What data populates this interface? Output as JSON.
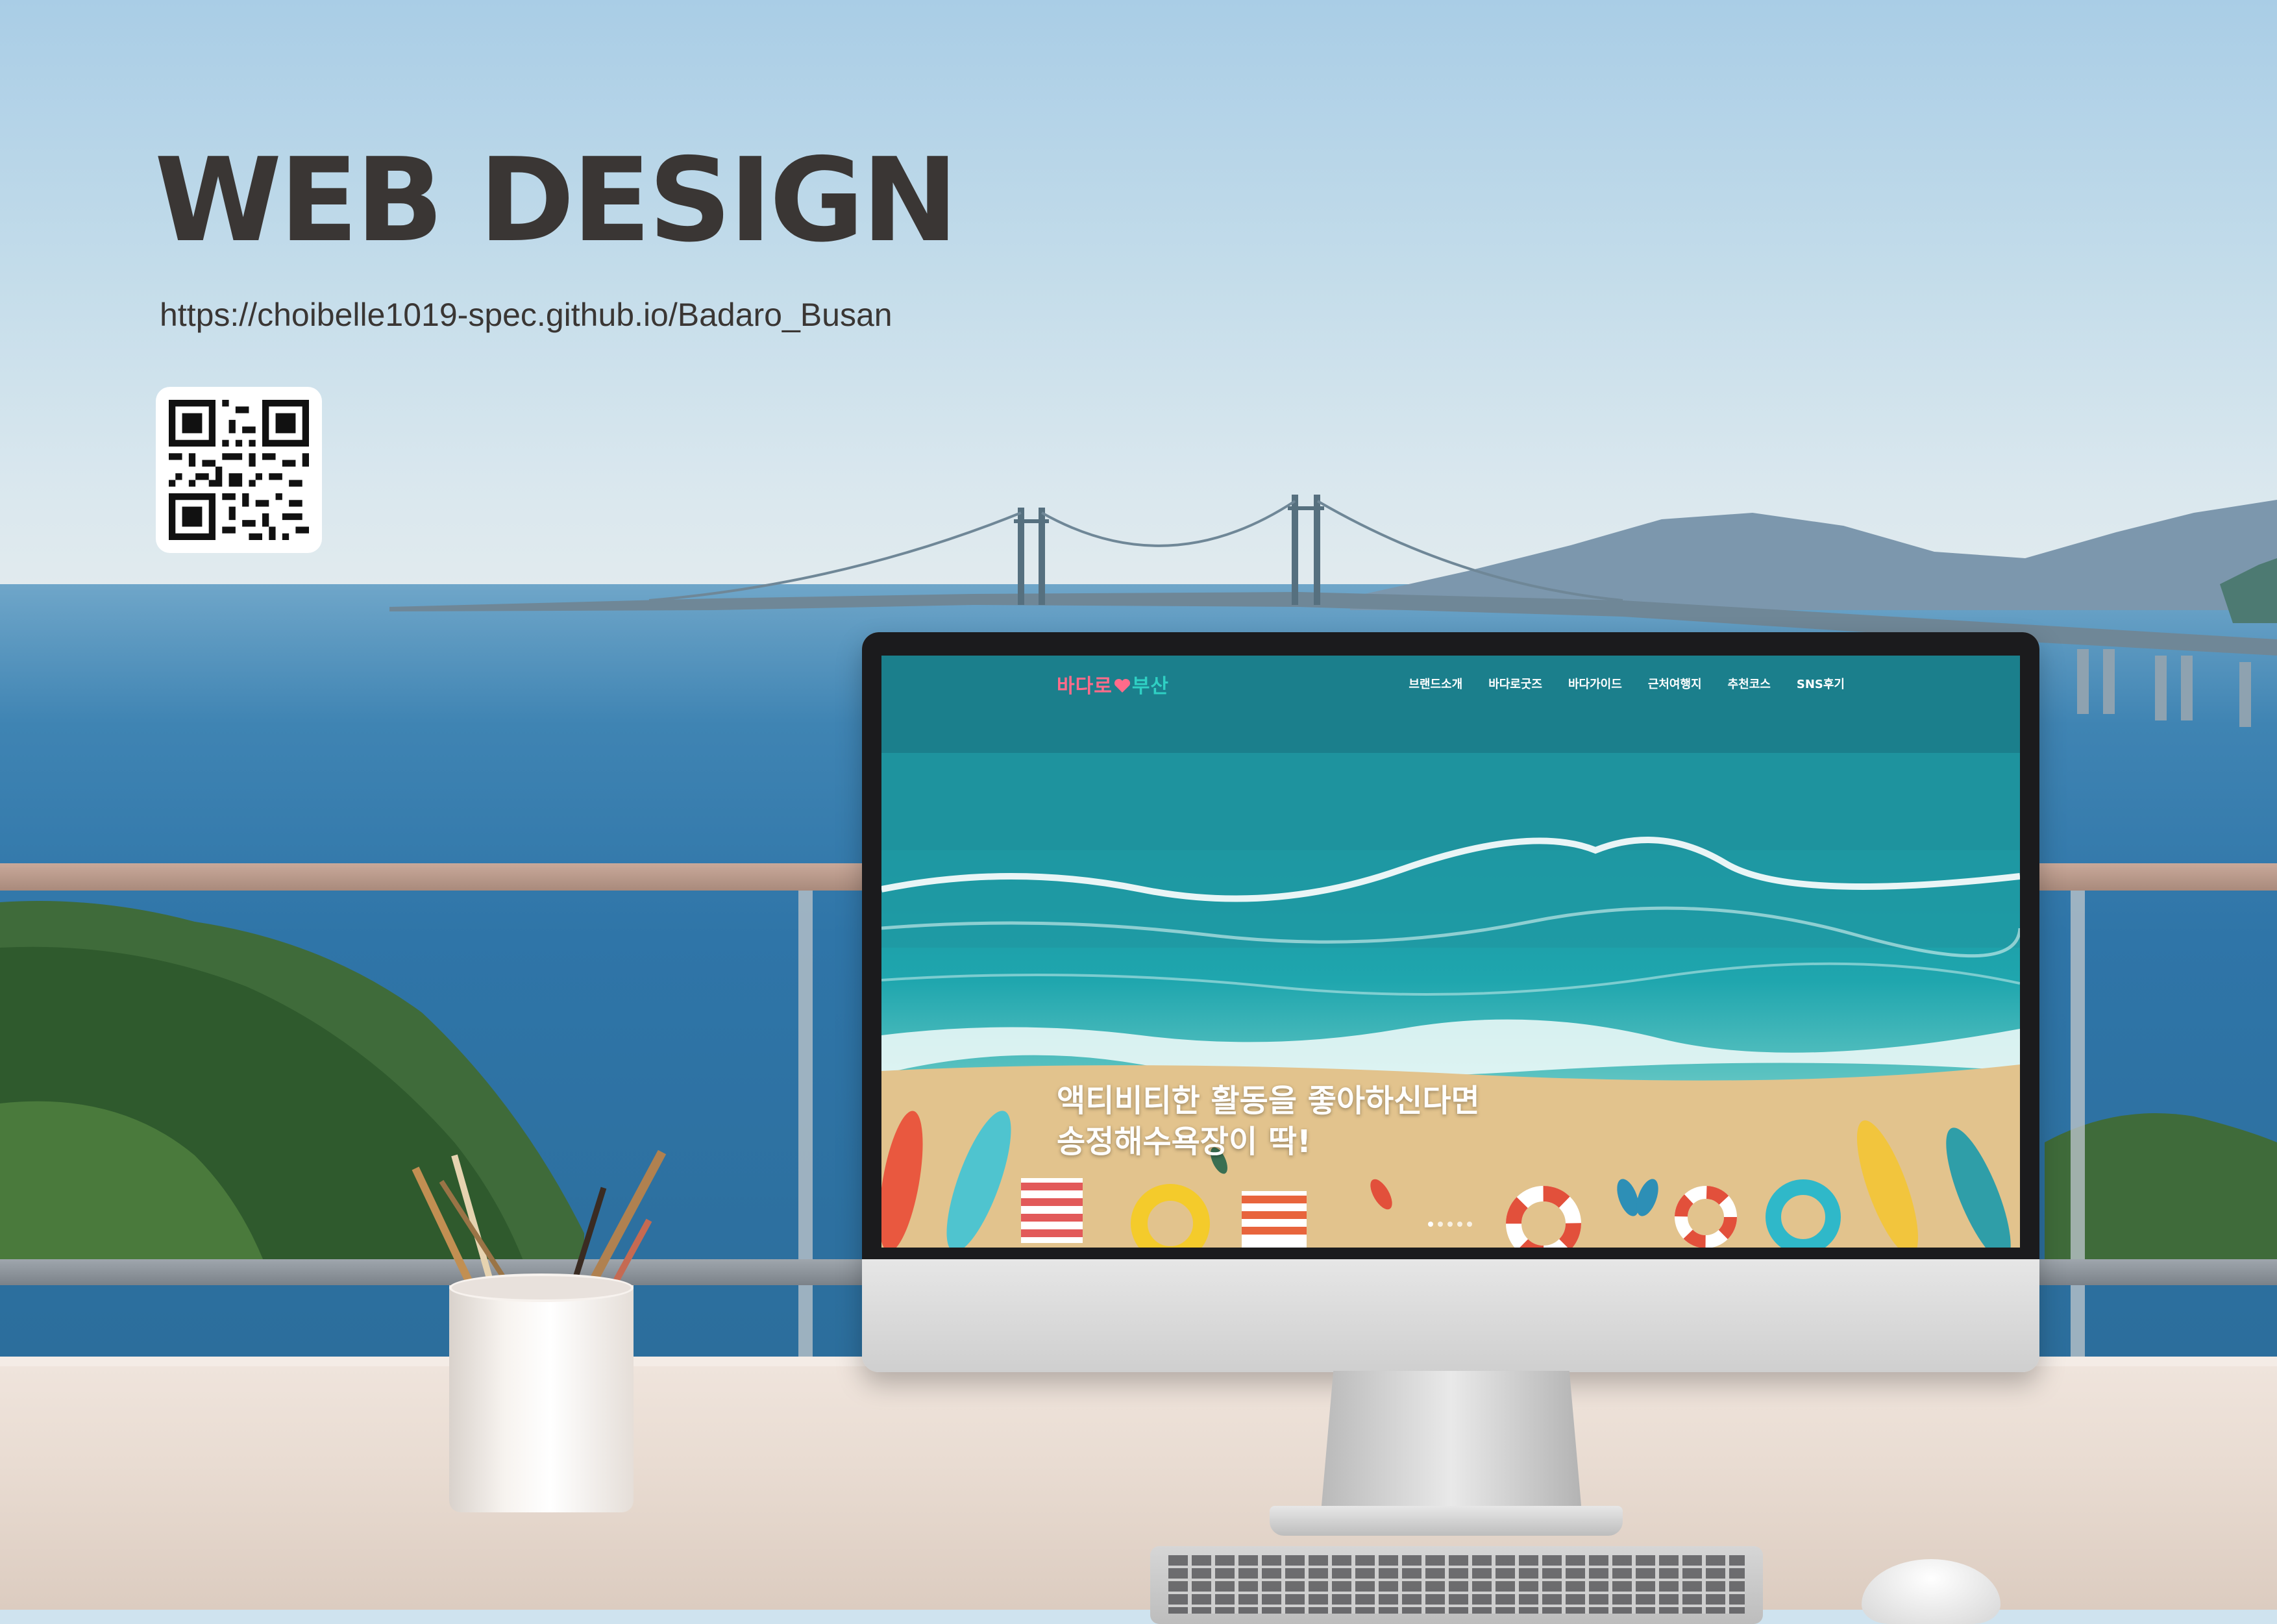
{
  "poster": {
    "title": "WEB DESIGN",
    "url": "https://choibelle1019-spec.github.io/Badaro_Busan"
  },
  "site": {
    "logo_part1": "바다로",
    "logo_part2": "부산",
    "nav": [
      "브랜드소개",
      "바다로굿즈",
      "바다가이드",
      "근처여행지",
      "추천코스",
      "SNS후기"
    ],
    "hero_line1": "액티비티한 활동을 좋아하신다면",
    "hero_line2": "송정해수욕장이 딱!",
    "slider_dots": 5,
    "active_dot": 0
  },
  "colors": {
    "title": "#3a3634",
    "logo_pink": "#ff6b8a",
    "logo_teal": "#2fd0c4",
    "sea": "#1fa6ae",
    "sand": "#e4c691"
  },
  "icons": [
    "qr-code-icon",
    "heart-icon"
  ]
}
